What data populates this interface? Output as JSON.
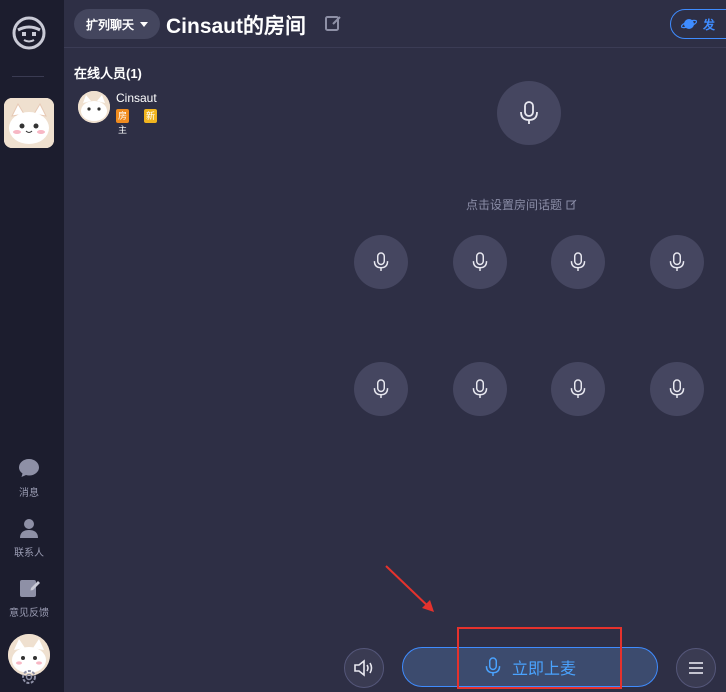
{
  "sidebar": {
    "items": [
      {
        "label": "消息",
        "icon": "chat-bubble-icon"
      },
      {
        "label": "联系人",
        "icon": "person-icon"
      },
      {
        "label": "意见反馈",
        "icon": "feedback-edit-icon"
      }
    ]
  },
  "header": {
    "mode_label": "扩列聊天",
    "room_title": "Cinsaut的房间",
    "share_label": "发"
  },
  "members": {
    "title": "在线人员(1)",
    "list": [
      {
        "name": "Cinsaut",
        "badge_owner": "房主",
        "badge_new": "新"
      }
    ]
  },
  "topic": {
    "label": "点击设置房间话题"
  },
  "bottom": {
    "mic_on_label": "立即上麦"
  },
  "colors": {
    "accent": "#3f8cff",
    "highlight": "#e5322d",
    "owner_badge": "#f08c1f",
    "new_badge": "#f1b51f"
  }
}
